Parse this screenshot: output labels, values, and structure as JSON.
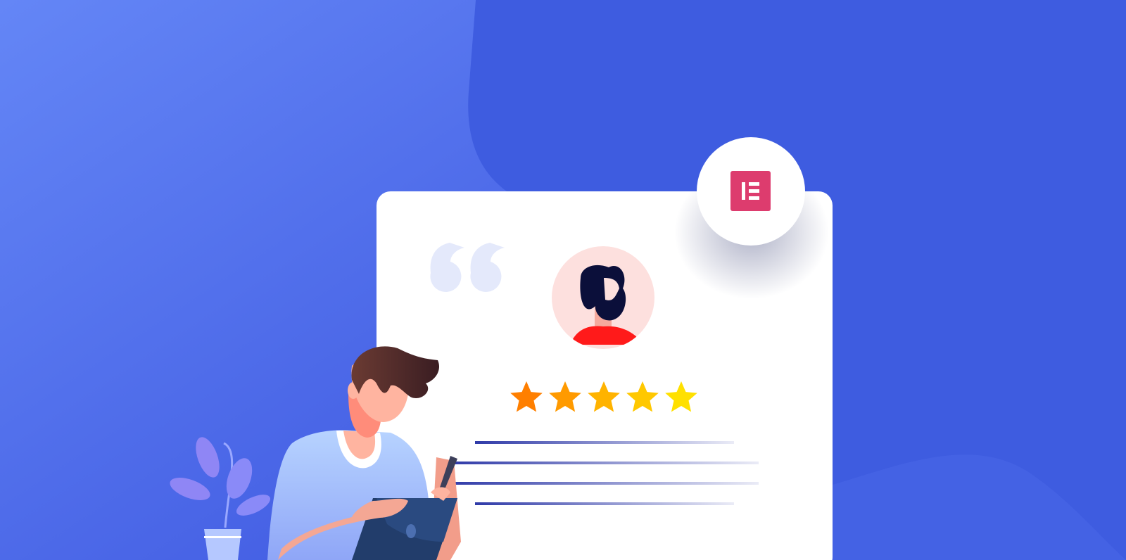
{
  "colors": {
    "background_light": "#6184f5",
    "background_dark": "#3e5ce0",
    "card": "#ffffff",
    "brand_badge": "#dd3c6e",
    "quote_mark": "#e4e9fb",
    "avatar_bg": "#fde0de",
    "shirt": "#ff1a1a",
    "hair": "#0b0f3a",
    "star_colors": [
      "#ff7f00",
      "#ff9a00",
      "#ffb300",
      "#ffc800",
      "#ffe000"
    ],
    "text_line": "#2f3aa8"
  },
  "review": {
    "rating": 5,
    "rating_max": 5,
    "text_line_count": 4
  },
  "icons": {
    "brand": "elementor-logo-icon",
    "quote": "quote-icon",
    "avatar": "user-avatar-icon",
    "star": "star-icon"
  }
}
